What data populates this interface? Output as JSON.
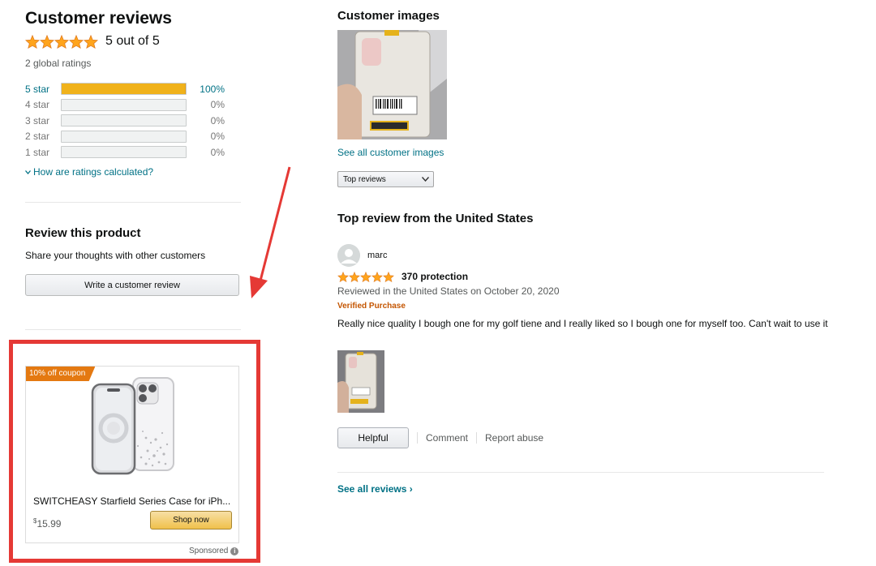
{
  "customer_reviews": {
    "title": "Customer reviews",
    "overall_rating_text": "5 out of 5",
    "overall_rating": 5,
    "global_ratings": "2 global ratings",
    "histogram": [
      {
        "label": "5 star",
        "percent": "100%",
        "fill": 1.0
      },
      {
        "label": "4 star",
        "percent": "0%",
        "fill": 0
      },
      {
        "label": "3 star",
        "percent": "0%",
        "fill": 0
      },
      {
        "label": "2 star",
        "percent": "0%",
        "fill": 0
      },
      {
        "label": "1 star",
        "percent": "0%",
        "fill": 0
      }
    ],
    "how_calculated": "How are ratings calculated?"
  },
  "review_product": {
    "title": "Review this product",
    "subtitle": "Share your thoughts with other customers",
    "button": "Write a customer review"
  },
  "ad": {
    "coupon": "10% off coupon",
    "name": "SWITCHEASY Starfield Series Case for iPh...",
    "price_symbol": "$",
    "price_value": "15.99",
    "shop_button": "Shop now",
    "sponsored": "Sponsored",
    "info_icon": "i"
  },
  "customer_images": {
    "title": "Customer images",
    "see_all": "See all customer images"
  },
  "sort": {
    "selected": "Top reviews"
  },
  "top_review": {
    "section_title": "Top review from the United States",
    "reviewer": "marc",
    "rating": 5,
    "headline": "370 protection",
    "date": "Reviewed in the United States on October 20, 2020",
    "verified": "Verified Purchase",
    "body": "Really nice quality I bough one for my golf tiene and I really liked so I bough one for myself too. Can't wait to use it",
    "helpful": "Helpful",
    "comment": "Comment",
    "report": "Report abuse"
  },
  "see_all_reviews": "See all reviews",
  "see_all_reviews_chevron": "›",
  "colors": {
    "star": "#ffa41c",
    "link": "#007185",
    "verified": "#c45500",
    "highlight_frame": "#e53935",
    "coupon": "#e47911"
  }
}
